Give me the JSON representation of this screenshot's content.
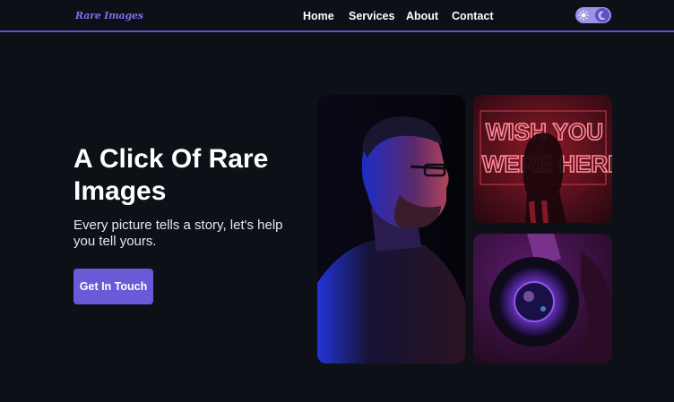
{
  "nav": {
    "logo": "Rare Images",
    "items": [
      {
        "label": "Home"
      },
      {
        "label": "Services"
      },
      {
        "label": "About"
      },
      {
        "label": "Contact"
      }
    ]
  },
  "theme_toggle": {
    "icons": [
      "sun-icon",
      "moon-icon"
    ],
    "active": "moon"
  },
  "hero": {
    "title": "A Click Of Rare Images",
    "subtitle": "Every picture tells a story, let's help you tell yours.",
    "cta_label": "Get In Touch"
  },
  "gallery": {
    "neon_sign_text": [
      "WISH YOU",
      "WERE HERE"
    ]
  },
  "colors": {
    "background": "#0d1017",
    "accent": "#6a5ad8",
    "nav_border": "#5b52c4",
    "toggle_bg": "#9a94e6"
  }
}
